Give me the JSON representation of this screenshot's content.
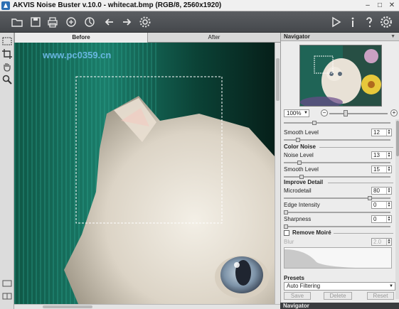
{
  "window": {
    "title": "AKVIS Noise Buster v.10.0 - whitecat.bmp (RGB/8, 2560x1920)",
    "controls": [
      "–",
      "□",
      "✕"
    ]
  },
  "toolbar": {
    "left_icons": [
      "open-icon",
      "save-icon",
      "print-icon",
      "share-icon",
      "undo-icon",
      "redo-icon",
      "settings-gear-icon"
    ],
    "right_icons": [
      "run-icon",
      "info-icon",
      "help-icon",
      "preferences-icon"
    ]
  },
  "watermark": "www.pc0359.cn",
  "tabs": {
    "before": "Before",
    "after": "After",
    "active": "before"
  },
  "navigator": {
    "title": "Navigator",
    "zoom": "100%",
    "zoom_minus": "−",
    "zoom_plus": "+",
    "zoom_level": 0.55
  },
  "settings": {
    "luminance_smooth": {
      "label": "Smooth Level",
      "value": "12",
      "level": 0.12
    },
    "color_noise": {
      "title": "Color Noise",
      "noise": {
        "label": "Noise Level",
        "value": "13",
        "level": 0.13
      },
      "smooth": {
        "label": "Smooth Level",
        "value": "15",
        "level": 0.15
      }
    },
    "improve_detail": {
      "title": "Improve Detail",
      "microdetail": {
        "label": "Microdetail",
        "value": "80",
        "level": 0.8
      },
      "edge_intensity": {
        "label": "Edge Intensity",
        "value": "0",
        "level": 0
      },
      "sharpness": {
        "label": "Sharpness",
        "value": "0",
        "level": 0
      }
    },
    "remove_moire": {
      "title": "Remove Moiré",
      "checked": false,
      "blur": {
        "label": "Blur",
        "value": "2.0"
      }
    }
  },
  "presets": {
    "title": "Presets",
    "selected": "Auto Filtering",
    "save": "Save",
    "delete": "Delete",
    "reset": "Reset"
  },
  "bottom_panel": {
    "title": "Navigator"
  }
}
